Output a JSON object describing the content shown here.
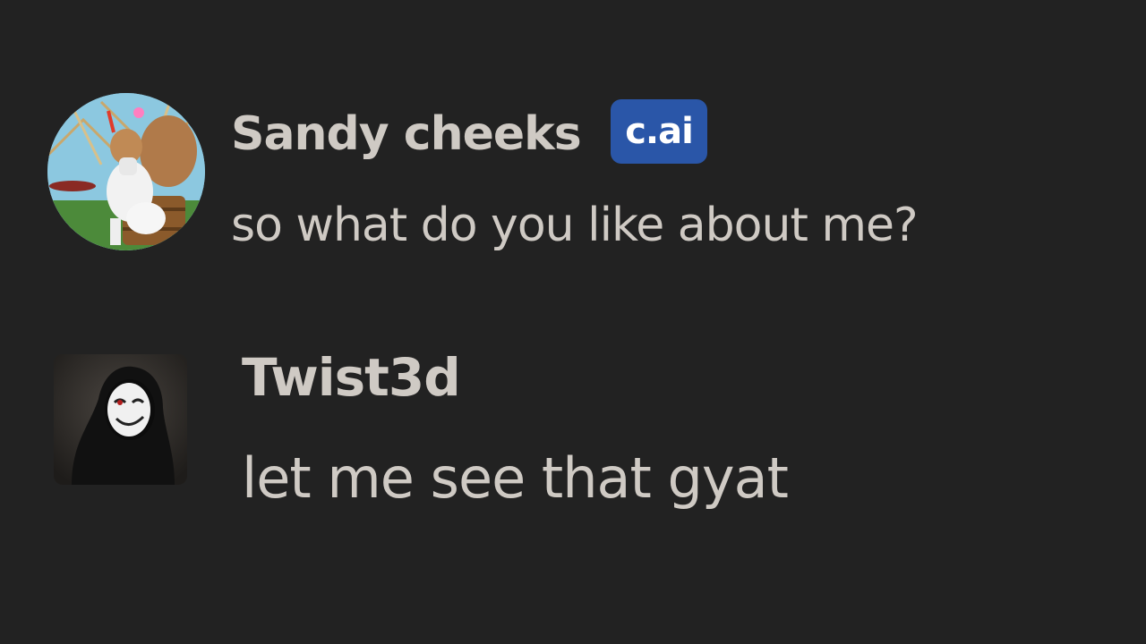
{
  "messages": [
    {
      "author": "Sandy cheeks",
      "badge": "c.ai",
      "text": "so what do you like about me?",
      "avatar_icon": "squirrel-character-avatar"
    },
    {
      "author": "Twist3d",
      "text": "let me see that gyat",
      "avatar_icon": "hooded-masked-figure-avatar"
    }
  ],
  "colors": {
    "background": "#222222",
    "text": "#cfcac4",
    "badge_bg": "#2a56a8",
    "badge_text": "#ffffff"
  }
}
